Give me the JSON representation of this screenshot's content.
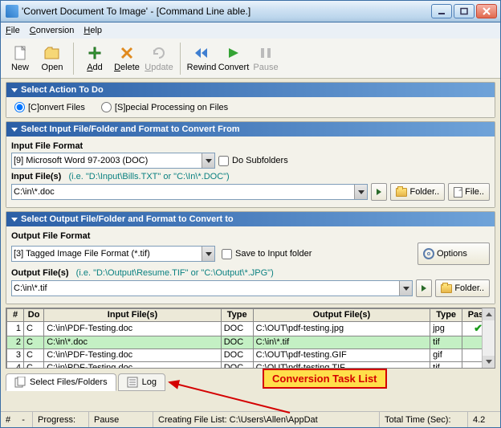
{
  "window": {
    "title": "'Convert Document To Image' - [Command Line able.]"
  },
  "menu": {
    "file": "File",
    "conversion": "Conversion",
    "help": "Help"
  },
  "toolbar": {
    "new": "New",
    "open": "Open",
    "add": "Add",
    "delete": "Delete",
    "update": "Update",
    "rewind": "Rewind",
    "convert": "Convert",
    "pause": "Pause"
  },
  "action": {
    "header": "Select Action To Do",
    "convert": "[C]onvert Files",
    "special": "[S]pecial Processing on Files"
  },
  "input": {
    "header": "Select Input File/Folder and Format to Convert From",
    "format_label": "Input File Format",
    "format_value": "[9] Microsoft Word 97-2003 (DOC)",
    "subfolders": "Do Subfolders",
    "files_label": "Input File(s)",
    "files_hint": "(i.e. \"D:\\Input\\Bills.TXT\"  or \"C:\\In\\*.DOC\")",
    "files_value": "C:\\in\\*.doc",
    "folder_btn": "Folder..",
    "file_btn": "File.."
  },
  "output": {
    "header": "Select Output File/Folder and Format to Convert to",
    "format_label": "Output File Format",
    "format_value": "[3] Tagged Image File Format (*.tif)",
    "save_input": "Save to Input folder",
    "options": "Options",
    "files_label": "Output File(s)",
    "files_hint": "(i.e. \"D:\\Output\\Resume.TIF\" or \"C:\\Output\\*.JPG\")",
    "files_value": "C:\\in\\*.tif",
    "folder_btn": "Folder.."
  },
  "table": {
    "cols": {
      "num": "#",
      "do": "Do",
      "in": "Input File(s)",
      "type1": "Type",
      "out": "Output File(s)",
      "type2": "Type",
      "pass": "Pass"
    },
    "rows": [
      {
        "n": "1",
        "do": "C",
        "in": "C:\\in\\PDF-Testing.doc",
        "t1": "DOC",
        "out": "C:\\OUT\\pdf-testing.jpg",
        "t2": "jpg",
        "pass": "check"
      },
      {
        "n": "2",
        "do": "C",
        "in": "C:\\in\\*.doc",
        "t1": "DOC",
        "out": "C:\\in\\*.tif",
        "t2": "tif",
        "pass": "",
        "hl": true
      },
      {
        "n": "3",
        "do": "C",
        "in": "C:\\in\\PDF-Testing.doc",
        "t1": "DOC",
        "out": "C:\\OUT\\pdf-testing.GIF",
        "t2": "gif",
        "pass": ""
      },
      {
        "n": "4",
        "do": "C",
        "in": "C:\\in\\PDF-Testing.doc",
        "t1": "DOC",
        "out": "C:\\OUT\\pdf-testing.TIF",
        "t2": "tif",
        "pass": ""
      }
    ]
  },
  "tabs": {
    "select": "Select Files/Folders",
    "log": "Log"
  },
  "annotation": "Conversion Task List",
  "status": {
    "num": "#",
    "slash": "-",
    "progress_lbl": "Progress:",
    "pause": "Pause",
    "creating": "Creating File List: C:\\Users\\Allen\\AppDat",
    "total_lbl": "Total Time (Sec):",
    "total_val": "4.2"
  }
}
